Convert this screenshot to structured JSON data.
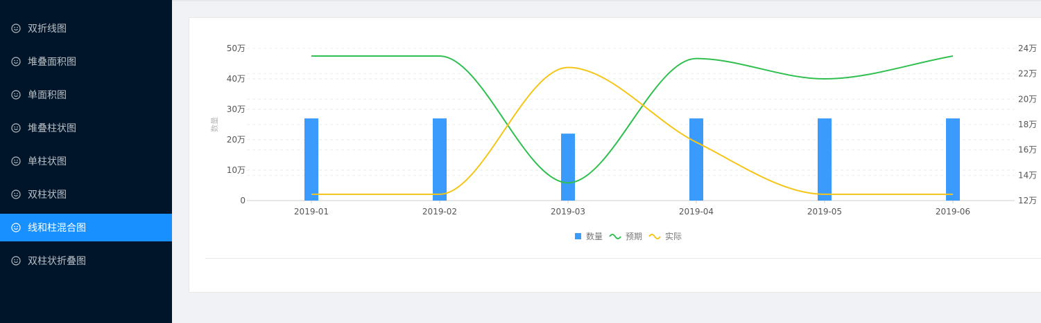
{
  "sidebar": {
    "items": [
      {
        "label": "双折线图",
        "icon": "smile-icon",
        "active": false
      },
      {
        "label": "堆叠面积图",
        "icon": "smile-icon",
        "active": false
      },
      {
        "label": "单面积图",
        "icon": "smile-icon",
        "active": false
      },
      {
        "label": "堆叠柱状图",
        "icon": "smile-icon",
        "active": false
      },
      {
        "label": "单柱状图",
        "icon": "smile-icon",
        "active": false
      },
      {
        "label": "双柱状图",
        "icon": "smile-icon",
        "active": false
      },
      {
        "label": "线和柱混合图",
        "icon": "smile-icon",
        "active": true
      },
      {
        "label": "双柱状折叠图",
        "icon": "smile-icon",
        "active": false
      }
    ],
    "colors": {
      "background": "#001529",
      "active": "#1890ff"
    }
  },
  "chart_data": {
    "type": "bar",
    "categories": [
      "2019-01",
      "2019-02",
      "2019-03",
      "2019-04",
      "2019-05",
      "2019-06"
    ],
    "series": [
      {
        "name": "数量",
        "type": "bar",
        "axis": "left",
        "color": "#3a9bfc",
        "values": [
          270000,
          270000,
          220000,
          270000,
          270000,
          270000
        ]
      },
      {
        "name": "预期",
        "type": "line",
        "smooth": true,
        "axis": "right",
        "color": "#2fbf4f",
        "values": [
          234000,
          234000,
          134000,
          232000,
          216000,
          234000
        ]
      },
      {
        "name": "实际",
        "type": "line",
        "smooth": true,
        "axis": "right",
        "color": "#f5c518",
        "values": [
          125000,
          125000,
          225000,
          166000,
          125000,
          125000
        ]
      }
    ],
    "y_left": {
      "label": "数量",
      "min": 0,
      "max": 500000,
      "ticks": [
        "0",
        "10万",
        "20万",
        "30万",
        "40万",
        "50万"
      ]
    },
    "y_right": {
      "min": 120000,
      "max": 240000,
      "ticks": [
        "12万",
        "14万",
        "16万",
        "18万",
        "20万",
        "22万",
        "24万"
      ]
    },
    "grid": true,
    "legend_position": "bottom"
  }
}
